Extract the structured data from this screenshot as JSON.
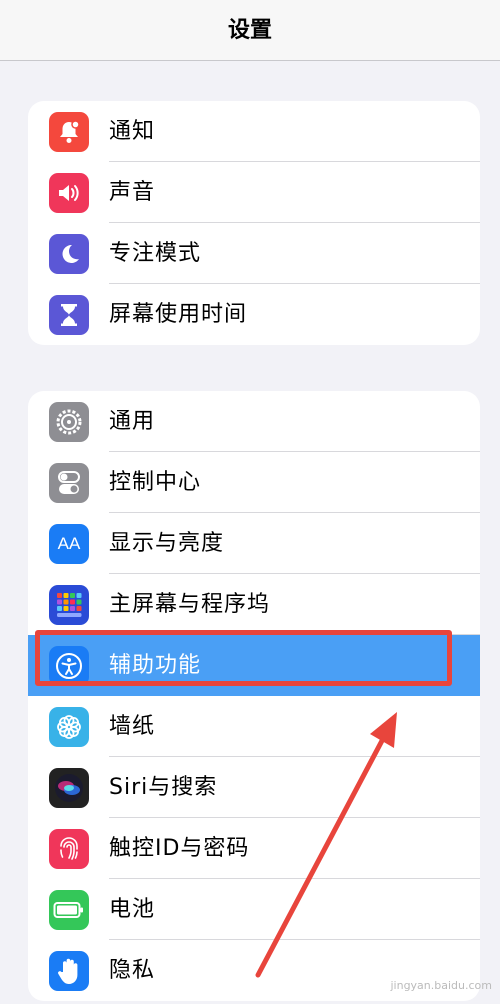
{
  "header": {
    "title": "设置"
  },
  "groups": [
    {
      "items": [
        {
          "label": "通知",
          "icon": "bell-icon",
          "color": "#f4483d"
        },
        {
          "label": "声音",
          "icon": "speaker-icon",
          "color": "#f0365a"
        },
        {
          "label": "专注模式",
          "icon": "moon-icon",
          "color": "#5b57d6"
        },
        {
          "label": "屏幕使用时间",
          "icon": "hourglass-icon",
          "color": "#5b57d6"
        }
      ]
    },
    {
      "items": [
        {
          "label": "通用",
          "icon": "gear-icon",
          "color": "#8e8e93"
        },
        {
          "label": "控制中心",
          "icon": "toggles-icon",
          "color": "#8e8e93"
        },
        {
          "label": "显示与亮度",
          "icon": "text-size-icon",
          "color": "#1a7cf5",
          "glyph": "AA"
        },
        {
          "label": "主屏幕与程序坞",
          "icon": "app-grid-icon",
          "color": "#2a4bd6"
        },
        {
          "label": "辅助功能",
          "icon": "accessibility-icon",
          "color": "#1a7cf5",
          "highlighted": true
        },
        {
          "label": "墙纸",
          "icon": "flower-icon",
          "color": "#38b2e8"
        },
        {
          "label": "Siri与搜索",
          "icon": "siri-icon",
          "color": "#222222"
        },
        {
          "label": "触控ID与密码",
          "icon": "fingerprint-icon",
          "color": "#f0365a"
        },
        {
          "label": "电池",
          "icon": "battery-icon",
          "color": "#34c759"
        },
        {
          "label": "隐私",
          "icon": "hand-icon",
          "color": "#1a7cf5"
        }
      ]
    }
  ],
  "annotation": {
    "box_color": "#e8453c",
    "arrow_color": "#e8453c"
  },
  "watermark": "jingyan.baidu.com"
}
